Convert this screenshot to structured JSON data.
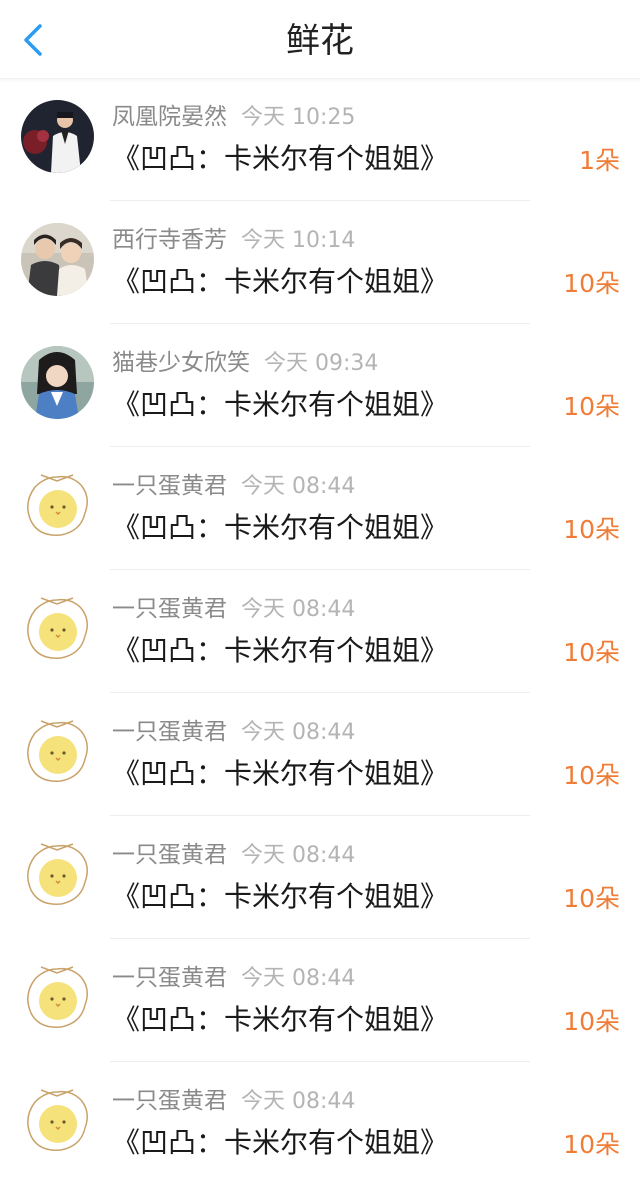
{
  "header": {
    "title": "鲜花",
    "back_icon": "chevron-left-icon",
    "accent_color": "#2b9cf2"
  },
  "items": [
    {
      "user": "凤凰院晏然",
      "time": "今天 10:25",
      "book": "《凹凸：卡米尔有个姐姐》",
      "count": "1朵",
      "avatar": "photo-man-suit"
    },
    {
      "user": "西行寺香芳",
      "time": "今天 10:14",
      "book": "《凹凸：卡米尔有个姐姐》",
      "count": "10朵",
      "avatar": "photo-two-people"
    },
    {
      "user": "猫巷少女欣笑",
      "time": "今天 09:34",
      "book": "《凹凸：卡米尔有个姐姐》",
      "count": "10朵",
      "avatar": "photo-costume"
    },
    {
      "user": "一只蛋黄君",
      "time": "今天 08:44",
      "book": "《凹凸：卡米尔有个姐姐》",
      "count": "10朵",
      "avatar": "egg-yolk-chick"
    },
    {
      "user": "一只蛋黄君",
      "time": "今天 08:44",
      "book": "《凹凸：卡米尔有个姐姐》",
      "count": "10朵",
      "avatar": "egg-yolk-chick"
    },
    {
      "user": "一只蛋黄君",
      "time": "今天 08:44",
      "book": "《凹凸：卡米尔有个姐姐》",
      "count": "10朵",
      "avatar": "egg-yolk-chick"
    },
    {
      "user": "一只蛋黄君",
      "time": "今天 08:44",
      "book": "《凹凸：卡米尔有个姐姐》",
      "count": "10朵",
      "avatar": "egg-yolk-chick"
    },
    {
      "user": "一只蛋黄君",
      "time": "今天 08:44",
      "book": "《凹凸：卡米尔有个姐姐》",
      "count": "10朵",
      "avatar": "egg-yolk-chick"
    },
    {
      "user": "一只蛋黄君",
      "time": "今天 08:44",
      "book": "《凹凸：卡米尔有个姐姐》",
      "count": "10朵",
      "avatar": "egg-yolk-chick"
    }
  ],
  "colors": {
    "count": "#ef7d37",
    "username": "#8a8a8a",
    "time": "#b4b4b4"
  }
}
